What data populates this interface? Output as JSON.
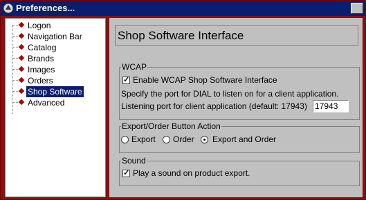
{
  "window": {
    "title": "Preferences..."
  },
  "tree": {
    "items": [
      {
        "label": "Logon"
      },
      {
        "label": "Navigation Bar"
      },
      {
        "label": "Catalog"
      },
      {
        "label": "Brands"
      },
      {
        "label": "Images"
      },
      {
        "label": "Orders"
      },
      {
        "label": "Shop Software",
        "selected": true
      },
      {
        "label": "Advanced"
      }
    ]
  },
  "panel": {
    "header": "Shop Software Interface",
    "wcap": {
      "legend": "WCAP",
      "enable_label": "Enable WCAP Shop Software Interface",
      "enable_checked": true,
      "desc": "Specify the port for DIAL to listen on for a client application.",
      "port_label": "Listening port for client application (default: 17943)",
      "port_value": "17943"
    },
    "export": {
      "legend": "Export/Order Button Action",
      "options": [
        "Export",
        "Order",
        "Export and Order"
      ],
      "selected": "Export and Order"
    },
    "sound": {
      "legend": "Sound",
      "label": "Play a sound on product export.",
      "checked": true
    }
  },
  "colors": {
    "title_bg": "#0a1e6e",
    "frame": "#8a0e12",
    "diamond": "#b00000"
  }
}
